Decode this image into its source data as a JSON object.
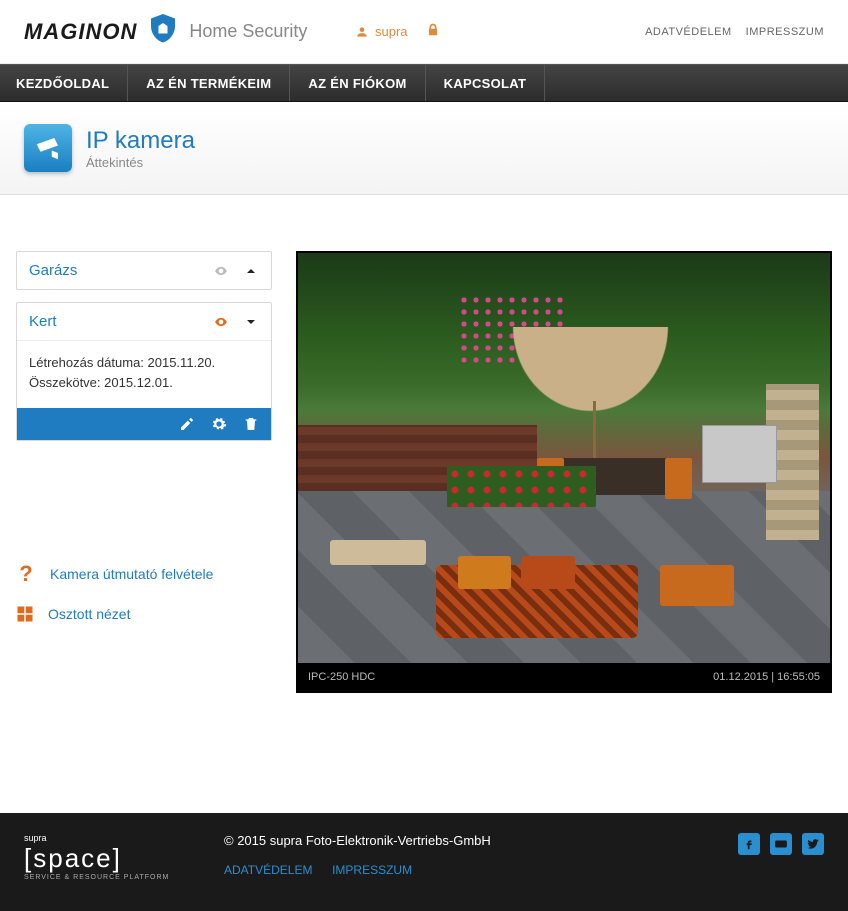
{
  "brand": {
    "name": "MAGINON",
    "suffix": "Home Security"
  },
  "user": {
    "name": "supra"
  },
  "top_links": [
    {
      "label": "ADATVÉDELEM"
    },
    {
      "label": "IMPRESSZUM"
    }
  ],
  "nav": [
    {
      "label": "KEZDŐOLDAL"
    },
    {
      "label": "AZ ÉN TERMÉKEIM"
    },
    {
      "label": "AZ ÉN FIÓKOM"
    },
    {
      "label": "KAPCSOLAT"
    }
  ],
  "page": {
    "title": "IP kamera",
    "subtitle": "Áttekintés"
  },
  "cameras": [
    {
      "name": "Garázs",
      "expanded": false,
      "viewing": false
    },
    {
      "name": "Kert",
      "expanded": true,
      "viewing": true,
      "created_line": "Létrehozás dátuma: 2015.11.20.",
      "connected_line": "Összekötve: 2015.12.01."
    }
  ],
  "side_links": {
    "wizard": "Kamera útmutató felvétele",
    "split": "Osztott nézet"
  },
  "viewer": {
    "model": "IPC-250 HDC",
    "timestamp": "01.12.2015 | 16:55:05"
  },
  "footer": {
    "brand_small": "supra",
    "brand_big": "space",
    "brand_tag": "SERVICE & RESOURCE PLATFORM",
    "copyright": "© 2015 supra Foto-Elektronik-Vertriebs-GmbH",
    "links": [
      {
        "label": "ADATVÉDELEM"
      },
      {
        "label": "IMPRESSZUM"
      }
    ]
  }
}
